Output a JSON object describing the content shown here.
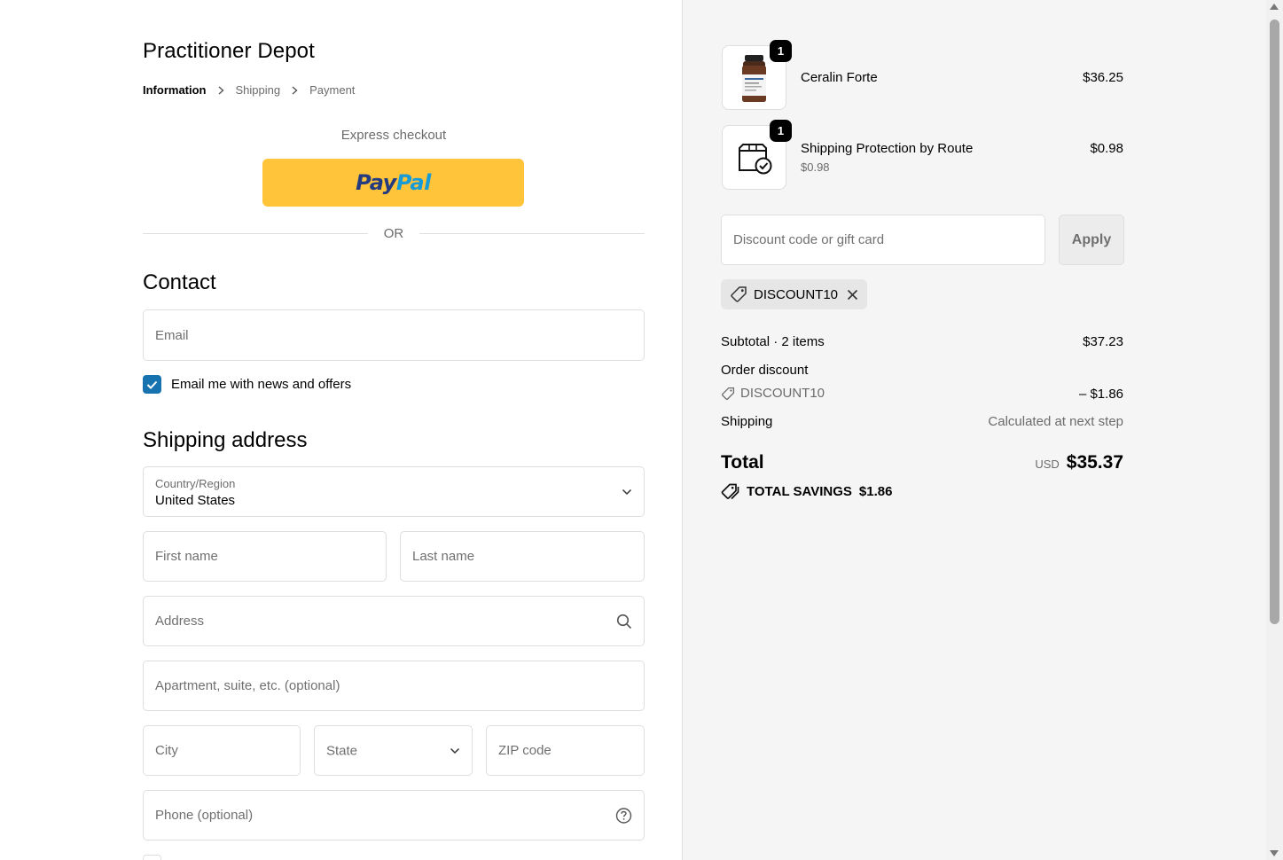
{
  "store": {
    "name": "Practitioner Depot"
  },
  "breadcrumbs": [
    "Information",
    "Shipping",
    "Payment"
  ],
  "express": {
    "label": "Express checkout",
    "paypal_a": "Pay",
    "paypal_b": "Pal",
    "or": "OR"
  },
  "contact": {
    "title": "Contact",
    "email_placeholder": "Email",
    "newsletter_label": "Email me with news and offers",
    "newsletter_checked": true
  },
  "shipping": {
    "title": "Shipping address",
    "country_label": "Country/Region",
    "country_value": "United States",
    "first_name": "First name",
    "last_name": "Last name",
    "address": "Address",
    "apartment": "Apartment, suite, etc. (optional)",
    "city": "City",
    "state": "State",
    "zip": "ZIP code",
    "phone": "Phone (optional)"
  },
  "cart": {
    "items": [
      {
        "name": "Ceralin Forte",
        "qty": "1",
        "price": "$36.25",
        "subtitle": ""
      },
      {
        "name": "Shipping Protection by Route",
        "qty": "1",
        "price": "$0.98",
        "subtitle": "$0.98"
      }
    ],
    "discount_placeholder": "Discount code or gift card",
    "apply_label": "Apply",
    "applied_code": "DISCOUNT10"
  },
  "summary": {
    "subtotal_label": "Subtotal · 2 items",
    "subtotal_value": "$37.23",
    "order_discount_label": "Order discount",
    "discount_code": "DISCOUNT10",
    "discount_value": "– $1.86",
    "shipping_label": "Shipping",
    "shipping_value": "Calculated at next step",
    "total_label": "Total",
    "currency": "USD",
    "total_value": "$35.37",
    "savings_label": "TOTAL SAVINGS",
    "savings_value": "$1.86"
  }
}
